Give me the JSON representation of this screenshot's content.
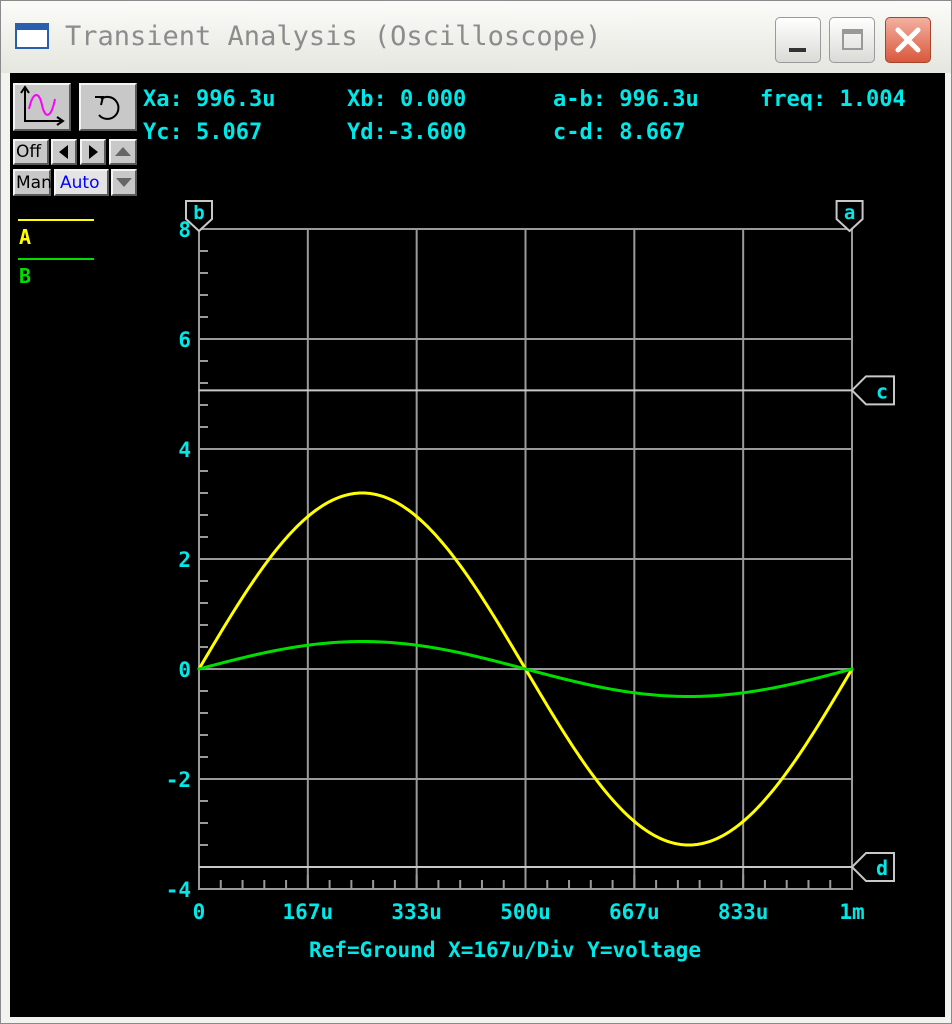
{
  "window": {
    "title": "Transient Analysis (Oscilloscope)"
  },
  "controls": {
    "off_label": "Off",
    "man_label": "Man",
    "auto_label": "Auto"
  },
  "readouts": {
    "xa": "Xa: 996.3u",
    "xb": "Xb: 0.000",
    "ab": "a-b: 996.3u",
    "freq": "freq: 1.004",
    "yc": "Yc: 5.067",
    "yd": "Yd:-3.600",
    "cd": "c-d: 8.667"
  },
  "colors": {
    "series_a": "#ffff00",
    "series_b": "#00dd00",
    "text": "#00e8e8",
    "grid": "#9a9a9a"
  },
  "chart_data": {
    "type": "line",
    "xlabel": "Ref=Ground  X=167u/Div Y=voltage",
    "x_tick_labels": [
      "0",
      "167u",
      "333u",
      "500u",
      "667u",
      "833u",
      "1m"
    ],
    "y_tick_labels": [
      "8",
      "6",
      "4",
      "2",
      "0",
      "-2",
      "-4"
    ],
    "xlim": [
      0,
      0.001
    ],
    "ylim": [
      -4,
      8
    ],
    "grid": true,
    "series": [
      {
        "name": "A",
        "color": "#ffff00",
        "x": [
          0,
          8.33e-05,
          0.0001667,
          0.00025,
          0.0003333,
          0.0004167,
          0.0005,
          0.0005833,
          0.0006667,
          0.00075,
          0.0008333,
          0.0009167,
          0.001
        ],
        "y": [
          0,
          1.6,
          2.77,
          3.2,
          2.77,
          1.6,
          0,
          -1.6,
          -2.77,
          -3.2,
          -2.77,
          -1.6,
          0
        ]
      },
      {
        "name": "B",
        "color": "#00dd00",
        "x": [
          0,
          8.33e-05,
          0.0001667,
          0.00025,
          0.0003333,
          0.0004167,
          0.0005,
          0.0005833,
          0.0006667,
          0.00075,
          0.0008333,
          0.0009167,
          0.001
        ],
        "y": [
          0,
          0.25,
          0.43,
          0.5,
          0.43,
          0.25,
          0,
          -0.25,
          -0.43,
          -0.5,
          -0.43,
          -0.25,
          0
        ]
      }
    ],
    "cursors": [
      {
        "label": "b",
        "axis": "x",
        "value": 0
      },
      {
        "label": "a",
        "axis": "x",
        "value": 0.0009963
      },
      {
        "label": "c",
        "axis": "y",
        "value": 5.067
      },
      {
        "label": "d",
        "axis": "y",
        "value": -3.6
      }
    ]
  }
}
